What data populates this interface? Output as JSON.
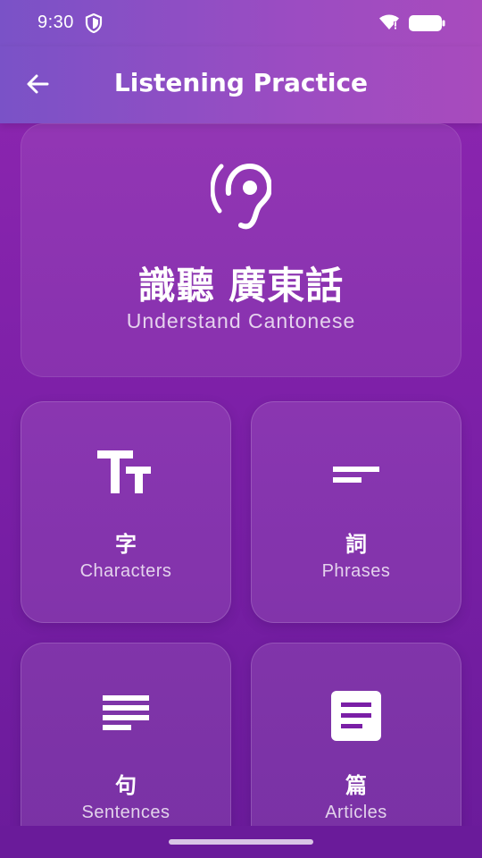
{
  "status_bar": {
    "time": "9:30"
  },
  "app_bar": {
    "title": "Listening Practice"
  },
  "hero": {
    "title_cn": "識聽 廣東話",
    "subtitle_en": "Understand Cantonese",
    "icon": "ear-icon"
  },
  "categories": [
    {
      "cn": "字",
      "en": "Characters",
      "icon": "text-fields-icon"
    },
    {
      "cn": "詞",
      "en": "Phrases",
      "icon": "short-text-icon"
    },
    {
      "cn": "句",
      "en": "Sentences",
      "icon": "notes-icon"
    },
    {
      "cn": "篇",
      "en": "Articles",
      "icon": "article-icon"
    }
  ]
}
